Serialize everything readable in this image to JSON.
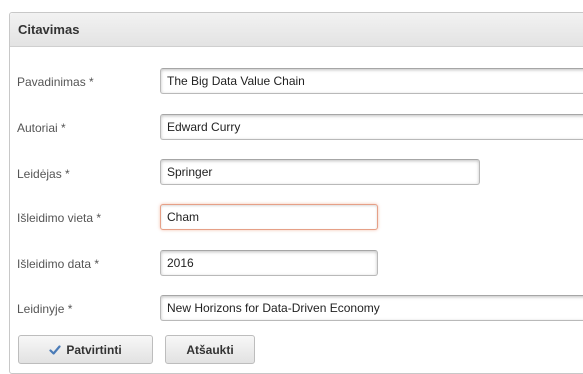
{
  "panel": {
    "title": "Citavimas"
  },
  "fields": [
    {
      "label": "Pavadinimas *",
      "value": "The Big Data Value Chain"
    },
    {
      "label": "Autoriai *",
      "value": "Edward Curry"
    },
    {
      "label": "Leidėjas *",
      "value": "Springer"
    },
    {
      "label": "Išleidimo vieta *",
      "value": "Cham"
    },
    {
      "label": "Išleidimo data *",
      "value": "2016"
    },
    {
      "label": "Leidinyje *",
      "value": "New Horizons for Data-Driven Economy"
    }
  ],
  "buttons": {
    "confirm_label": "Patvirtinti",
    "confirm_icon": "check-icon",
    "cancel_label": "Atšaukti"
  },
  "colors": {
    "focus_border": "#e6a087",
    "check_icon": "#4a7bb7"
  }
}
